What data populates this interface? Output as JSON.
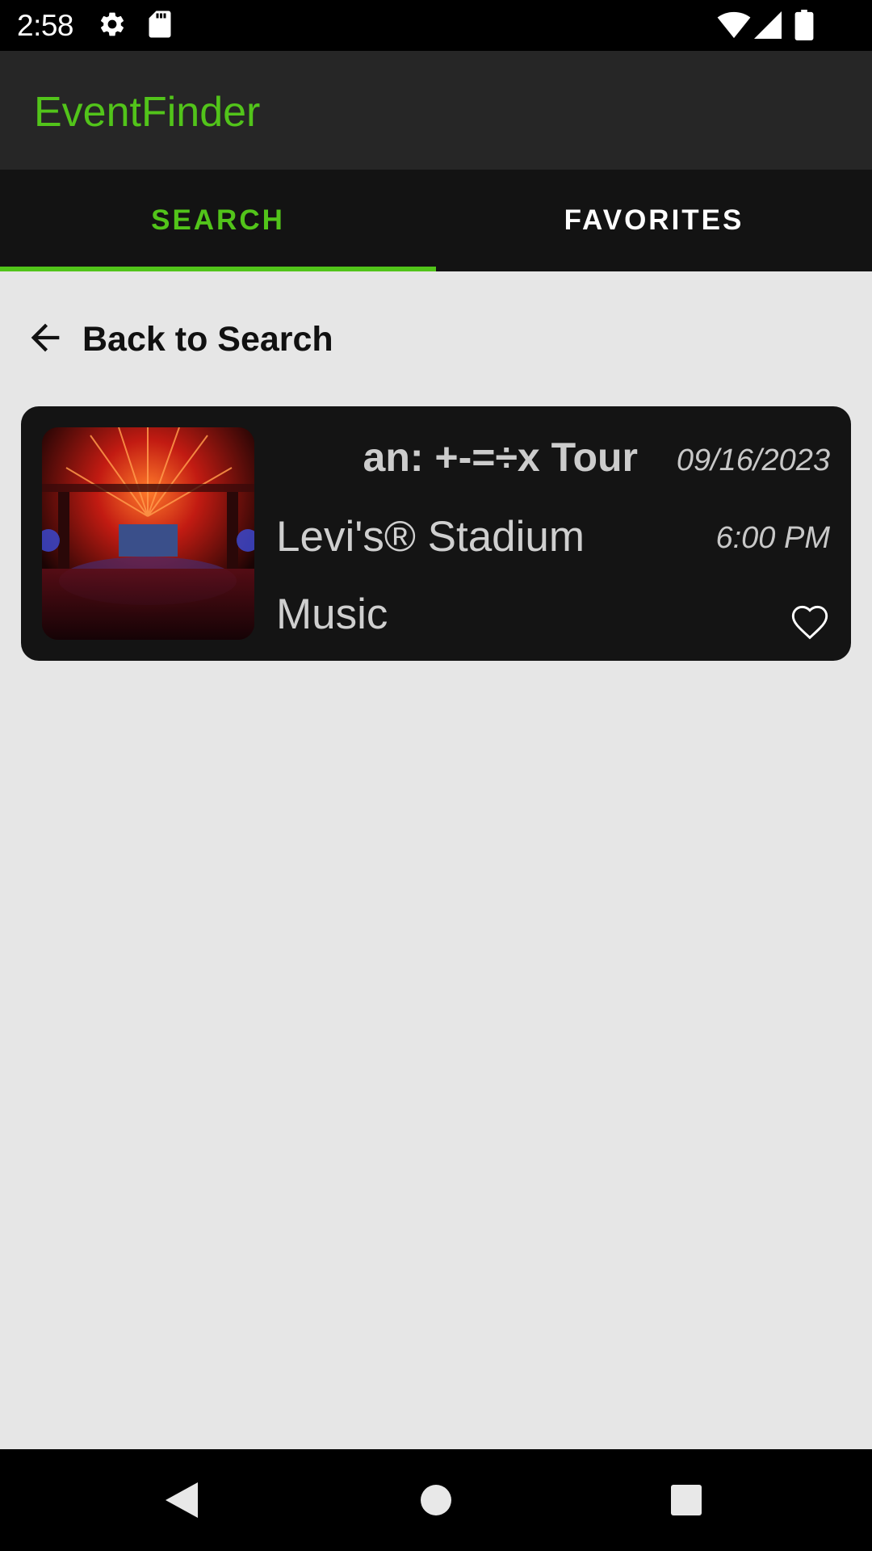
{
  "status_bar": {
    "time": "2:58",
    "icons": [
      "gear-icon",
      "sd-card-icon",
      "wifi-icon",
      "cell-signal-icon",
      "battery-icon"
    ]
  },
  "app_bar": {
    "title": "EventFinder",
    "accent_color": "#52c41a"
  },
  "tabs": [
    {
      "label": "SEARCH",
      "selected": true
    },
    {
      "label": "FAVORITES",
      "selected": false
    }
  ],
  "back_link": {
    "label": "Back to Search",
    "icon": "arrow-back-icon"
  },
  "event": {
    "title": "an: +-=÷x Tour",
    "date": "09/16/2023",
    "venue": "Levi's® Stadium",
    "time": "6:00 PM",
    "genre": "Music",
    "favorite_icon": "heart-outline-icon",
    "favorited": false
  },
  "nav_bar": {
    "icons": [
      "nav-back-icon",
      "nav-home-icon",
      "nav-recents-icon"
    ]
  }
}
